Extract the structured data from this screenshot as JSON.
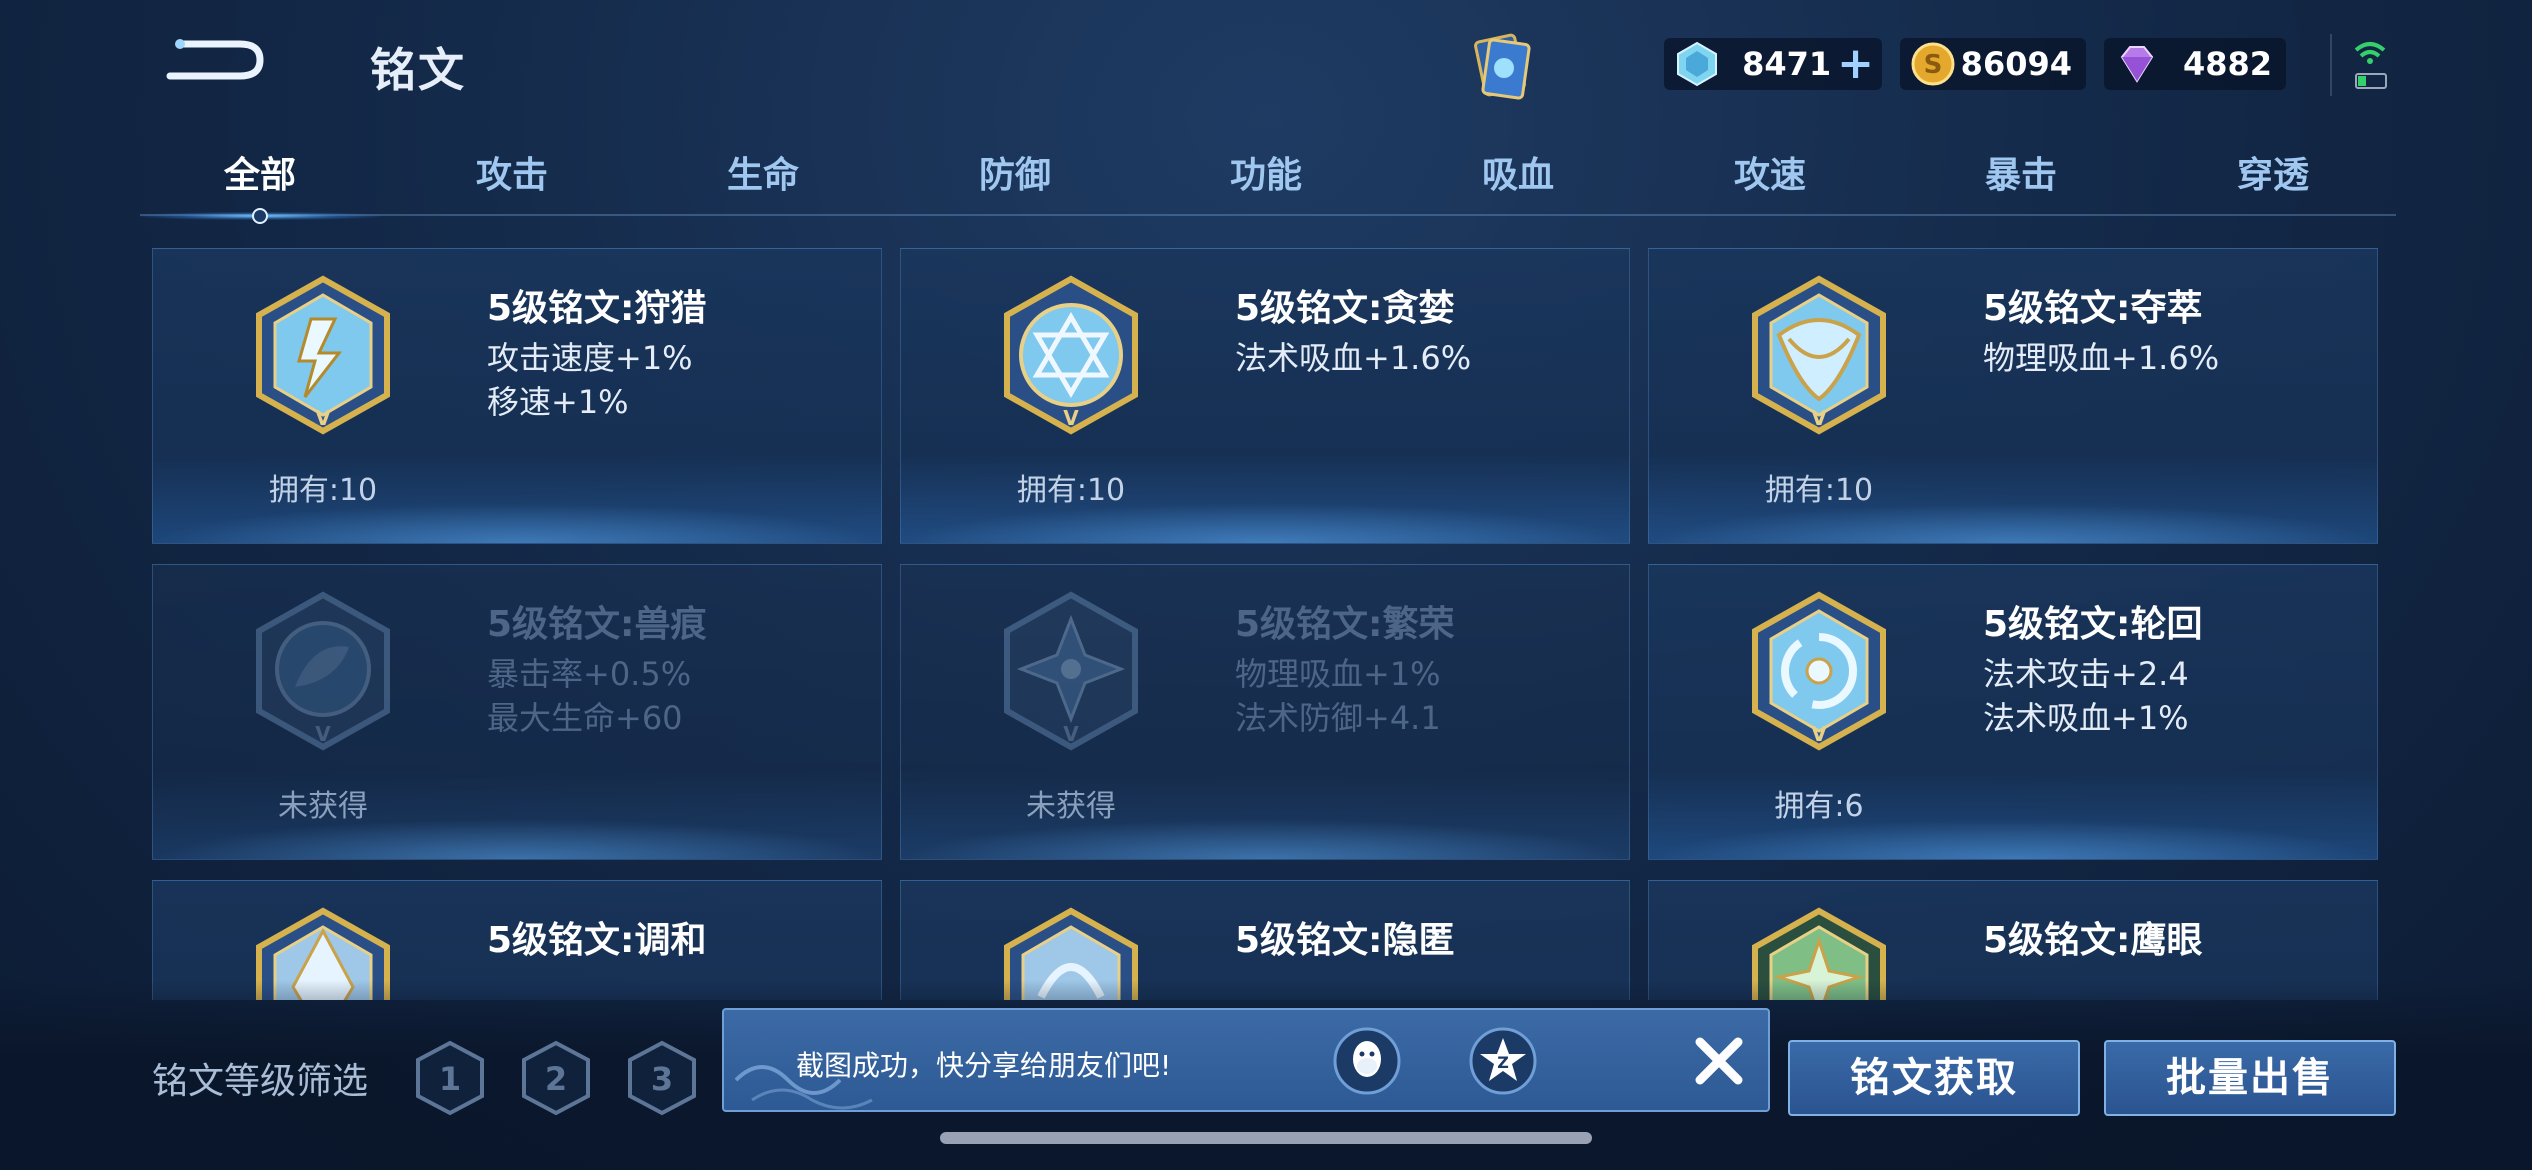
{
  "header": {
    "title": "铭文",
    "currencies": [
      {
        "icon": "crystal-icon",
        "value": "8471"
      },
      {
        "icon": "gold-coin-icon",
        "value": "86094"
      },
      {
        "icon": "diamond-icon",
        "value": "4882"
      }
    ]
  },
  "tabs": [
    "全部",
    "攻击",
    "生命",
    "防御",
    "功能",
    "吸血",
    "攻速",
    "暴击",
    "穿透"
  ],
  "active_tab": 0,
  "cards": [
    {
      "name": "5级铭文:狩猎",
      "stat1": "攻击速度+1%",
      "stat2": "移速+1%",
      "owned": "拥有:10",
      "color": "#7fc8ee"
    },
    {
      "name": "5级铭文:贪婪",
      "stat1": "法术吸血+1.6%",
      "stat2": "",
      "owned": "拥有:10",
      "color": "#7fc8ee"
    },
    {
      "name": "5级铭文:夺萃",
      "stat1": "物理吸血+1.6%",
      "stat2": "",
      "owned": "拥有:10",
      "color": "#7fc8ee"
    },
    {
      "name": "5级铭文:兽痕",
      "stat1": "暴击率+0.5%",
      "stat2": "最大生命+60",
      "owned": "未获得",
      "color": "#6b8fb8"
    },
    {
      "name": "5级铭文:繁荣",
      "stat1": "物理吸血+1%",
      "stat2": "法术防御+4.1",
      "owned": "未获得",
      "color": "#6b8fb8"
    },
    {
      "name": "5级铭文:轮回",
      "stat1": "法术攻击+2.4",
      "stat2": "法术吸血+1%",
      "owned": "拥有:6",
      "color": "#7fc8ee"
    },
    {
      "name": "5级铭文:调和",
      "stat1": "",
      "stat2": "",
      "owned": "",
      "color": "#9fc7e8"
    },
    {
      "name": "5级铭文:隐匿",
      "stat1": "",
      "stat2": "",
      "owned": "",
      "color": "#9fc7e8"
    },
    {
      "name": "5级铭文:鹰眼",
      "stat1": "",
      "stat2": "",
      "owned": "",
      "color": "#7fbf86"
    }
  ],
  "filter": {
    "label": "铭文等级筛选",
    "levels": [
      "1",
      "2",
      "3"
    ]
  },
  "toast": {
    "text": "截图成功，快分享给朋友们吧!"
  },
  "buttons": {
    "obtain": "铭文获取",
    "sell": "批量出售"
  }
}
